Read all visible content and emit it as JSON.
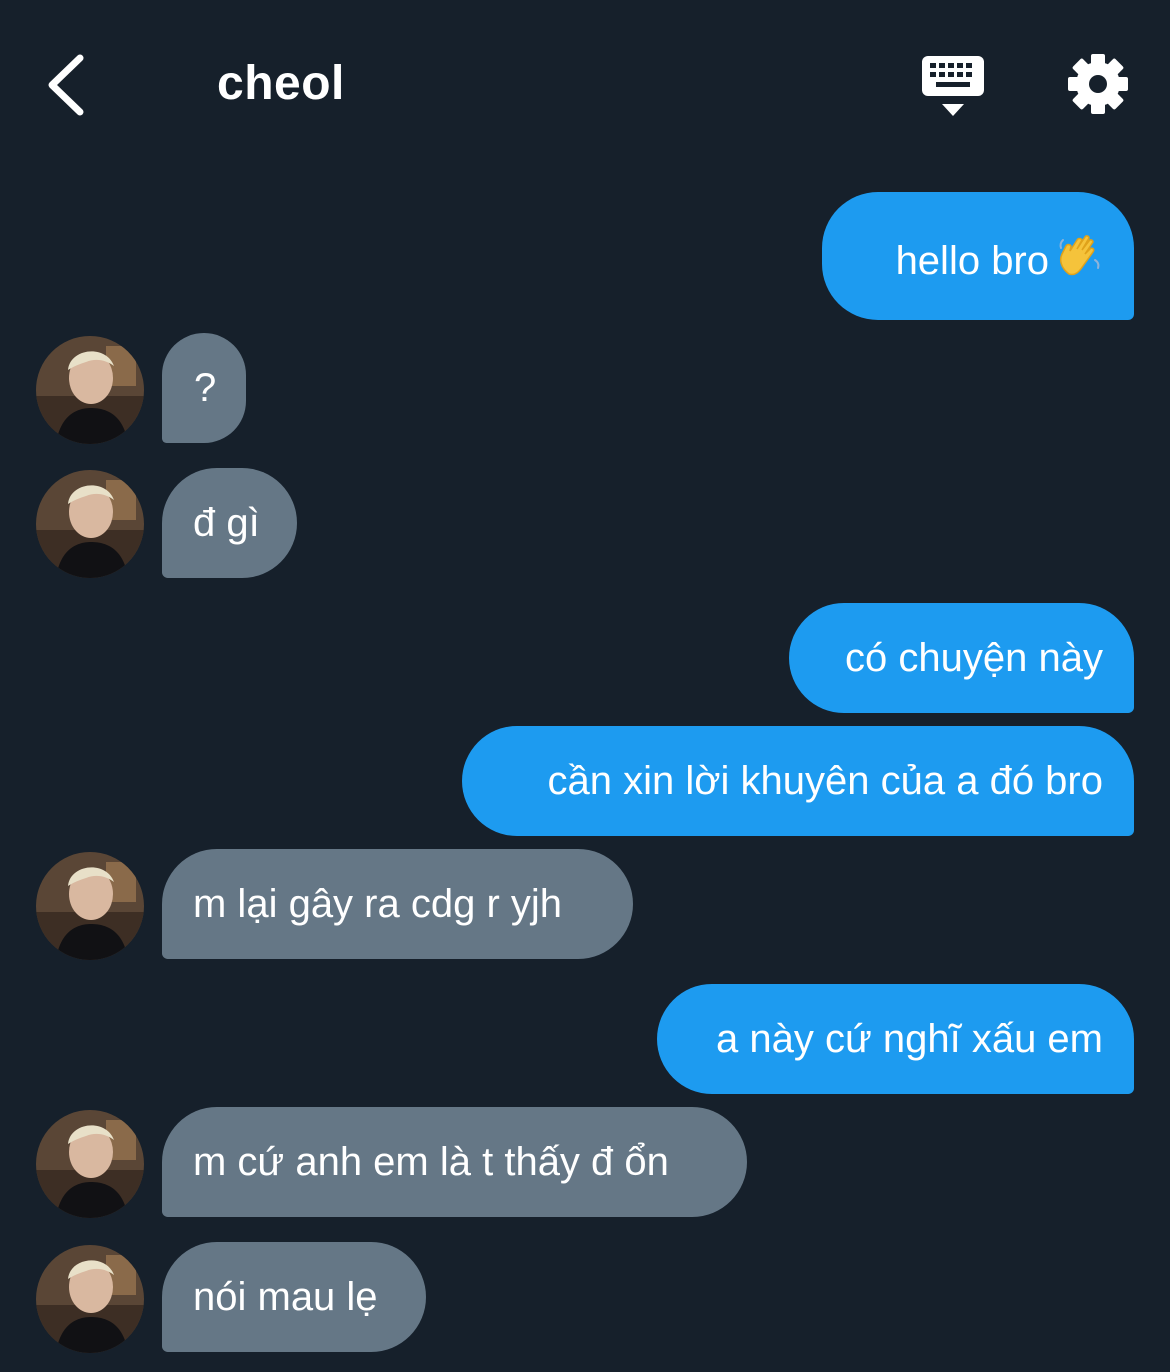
{
  "header": {
    "title": "cheol",
    "back_icon": "chevron-left-icon",
    "keyboard_icon": "keyboard-icon",
    "settings_icon": "gear-icon"
  },
  "colors": {
    "background": "#16202b",
    "outgoing_bubble": "#1d9bf0",
    "incoming_bubble": "#657786",
    "text": "#ffffff"
  },
  "messages": [
    {
      "side": "out",
      "text": "hello bro",
      "emoji": "waving-hand-icon"
    },
    {
      "side": "in",
      "text": "?"
    },
    {
      "side": "in",
      "text": "đ gì"
    },
    {
      "side": "out",
      "text": "có chuyện này"
    },
    {
      "side": "out",
      "text": "cần xin lời khuyên của a đó bro"
    },
    {
      "side": "in",
      "text": "m lại gây ra cdg r yjh"
    },
    {
      "side": "out",
      "text": "a này cứ nghĩ xấu em"
    },
    {
      "side": "in",
      "text": "m cứ anh em là t thấy đ ổn"
    },
    {
      "side": "in",
      "text": "nói mau lẹ"
    }
  ]
}
